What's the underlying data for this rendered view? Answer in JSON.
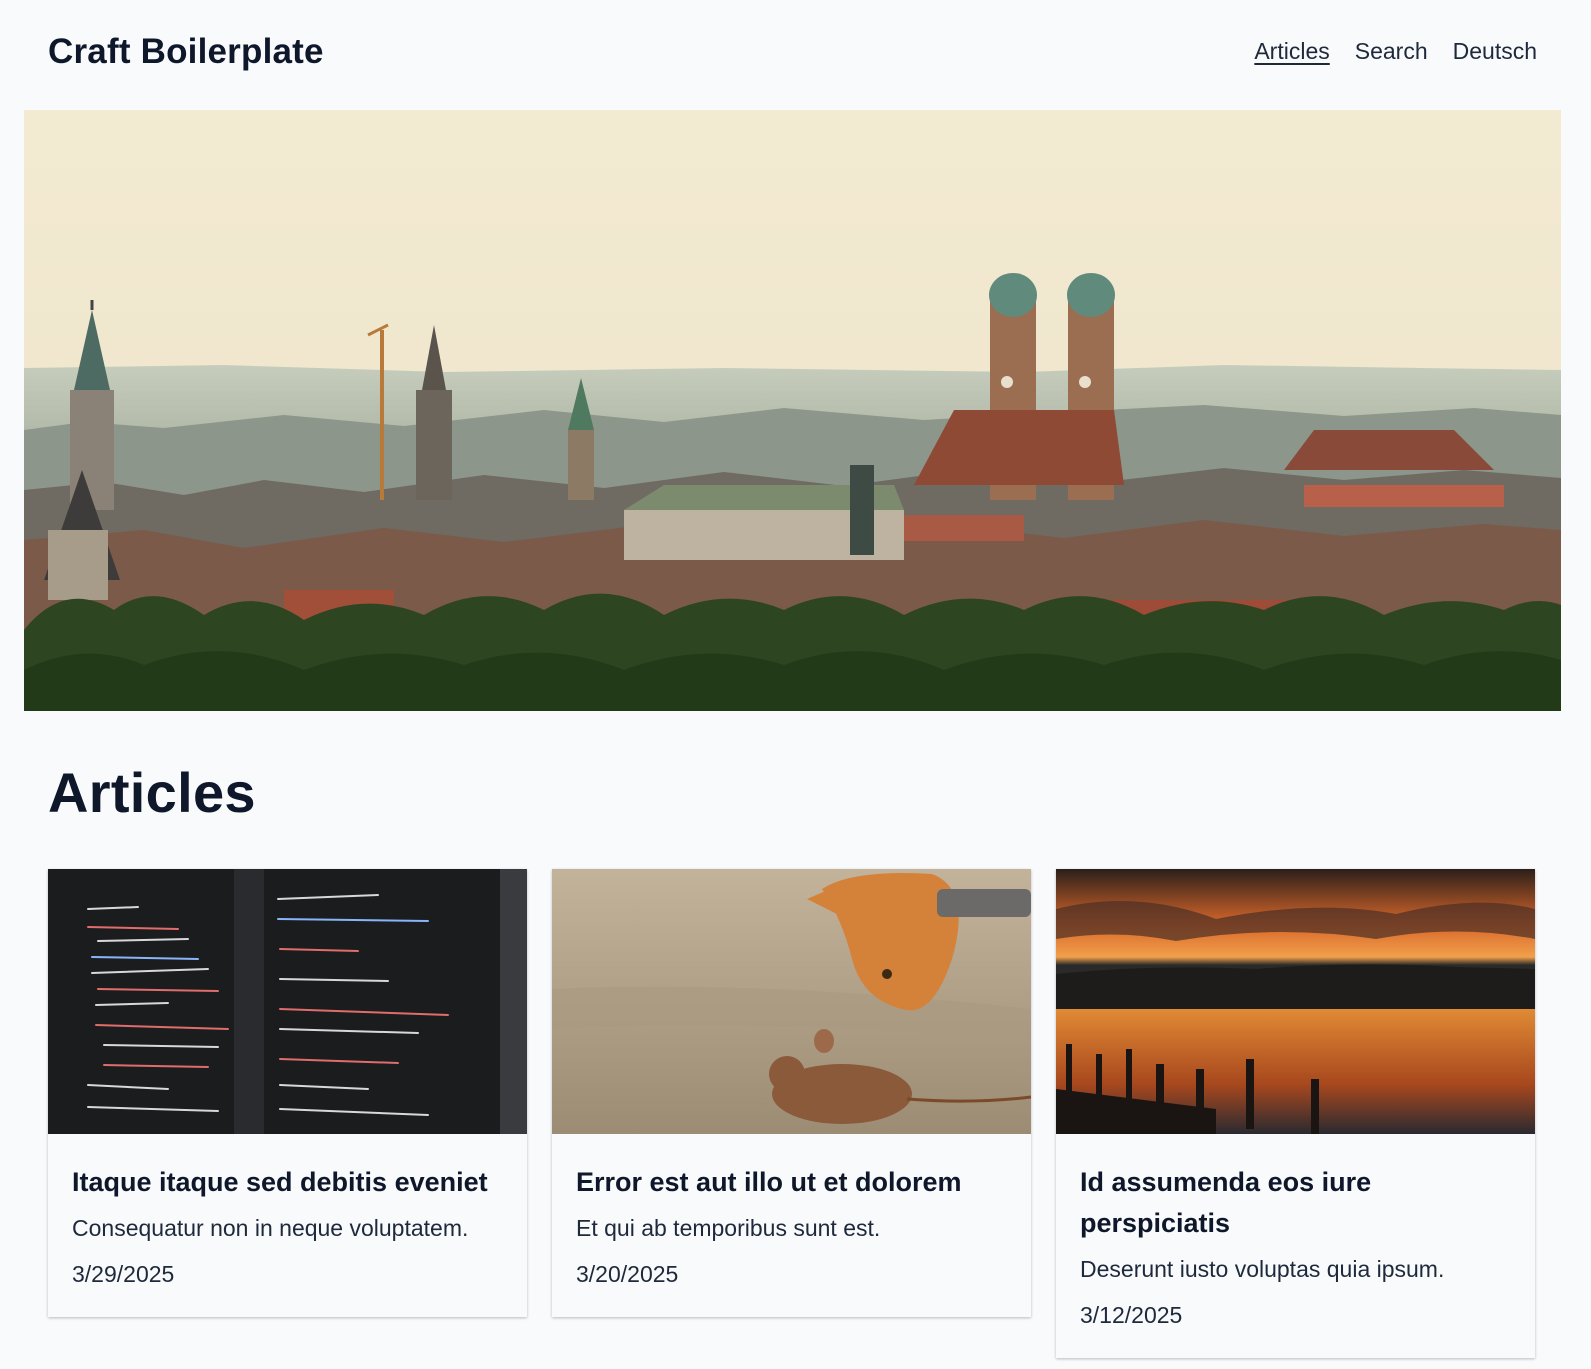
{
  "header": {
    "site_title": "Craft Boilerplate",
    "nav": [
      {
        "label": "Articles",
        "active": true
      },
      {
        "label": "Search",
        "active": false
      },
      {
        "label": "Deutsch",
        "active": false
      }
    ]
  },
  "hero": {
    "image": "munich-skyline-photo"
  },
  "main": {
    "heading": "Articles",
    "articles": [
      {
        "image": "code-screen-photo",
        "title": "Itaque itaque sed debitis eveniet",
        "excerpt": "Consequatur non in neque voluptatem.",
        "date": "3/29/2025"
      },
      {
        "image": "cat-and-mouse-photo",
        "title": "Error est aut illo ut et dolorem",
        "excerpt": "Et qui ab temporibus sunt est.",
        "date": "3/20/2025"
      },
      {
        "image": "lake-sunset-photo",
        "title": "Id assumenda eos iure perspiciatis",
        "excerpt": "Deserunt iusto voluptas quia ipsum.",
        "date": "3/12/2025"
      }
    ]
  },
  "colors": {
    "background": "#f8fafc",
    "text": "#0f172a",
    "sky": "#efe6cc"
  }
}
